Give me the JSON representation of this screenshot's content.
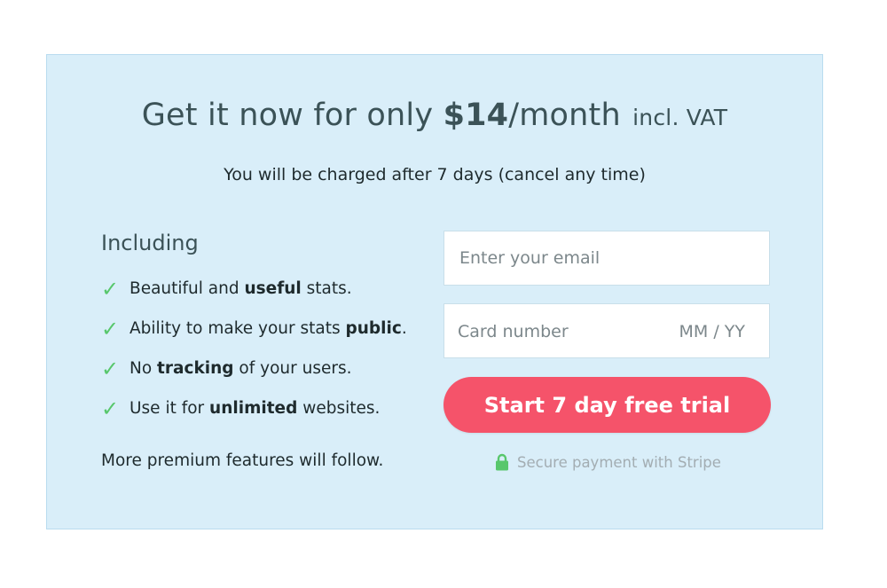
{
  "headline": {
    "prefix": "Get it now for only ",
    "price": "$14",
    "period": "/month",
    "vat": "incl. VAT"
  },
  "subline": "You will be charged after 7 days (cancel any time)",
  "features": {
    "title": "Including",
    "check_icon": "checkmark-icon",
    "check_color": "#58c76c",
    "items": [
      {
        "pre": "Beautiful and ",
        "bold": "useful",
        "post": " stats."
      },
      {
        "pre": "Ability to make your stats ",
        "bold": "public",
        "post": "."
      },
      {
        "pre": "No ",
        "bold": "tracking",
        "post": " of your users."
      },
      {
        "pre": "Use it for ",
        "bold": "unlimited",
        "post": " websites."
      }
    ],
    "more": "More premium features will follow."
  },
  "form": {
    "email_placeholder": "Enter your email",
    "email_value": "",
    "card_number_placeholder": "Card number",
    "card_expiry_placeholder": "MM / YY",
    "submit_label": "Start 7 day free trial",
    "submit_color": "#f5536a",
    "secure_text": "Secure payment with Stripe",
    "secure_icon": "lock-icon",
    "lock_color": "#58c76c"
  },
  "colors": {
    "panel_bg": "#d9eef9",
    "heading": "#3b5257"
  }
}
